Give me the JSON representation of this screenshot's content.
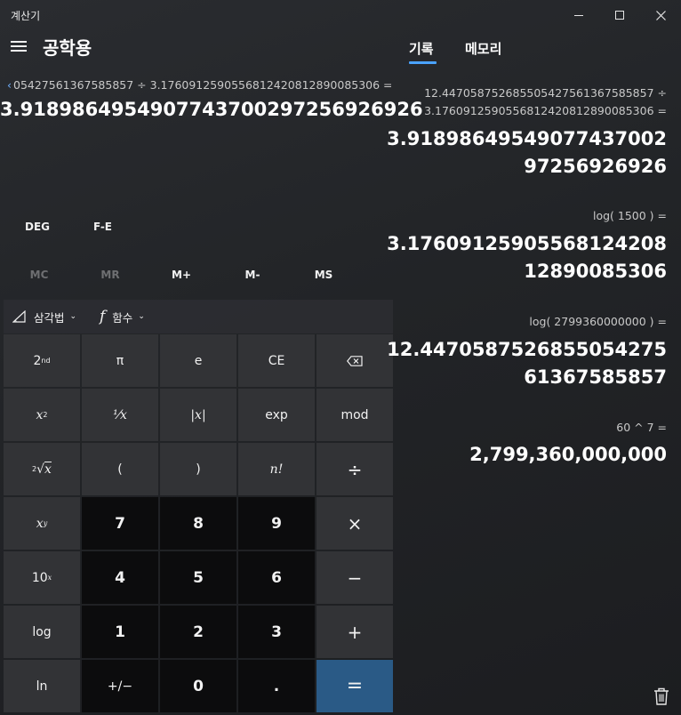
{
  "app": {
    "title": "계산기",
    "mode": "공학용"
  },
  "display": {
    "expression": "05427561367585857 ÷ 3.1760912590556812420812890085306 =",
    "result": "3.9189864954907743700297256926926"
  },
  "modes": {
    "angle": "DEG",
    "fe": "F-E"
  },
  "memory_buttons": [
    {
      "label": "MC",
      "enabled": false
    },
    {
      "label": "MR",
      "enabled": false
    },
    {
      "label": "M+",
      "enabled": true
    },
    {
      "label": "M-",
      "enabled": true
    },
    {
      "label": "MS",
      "enabled": true
    }
  ],
  "function_row": {
    "trig": "삼각법",
    "func": "함수"
  },
  "keys": {
    "second": "2",
    "second_sup": "nd",
    "pi": "π",
    "e": "e",
    "ce": "CE",
    "x": "x",
    "two": "2",
    "reciprocal": "⅟x",
    "abs": "|x|",
    "exp": "exp",
    "mod": "mod",
    "root_index": "2",
    "root_x": "x",
    "lparen": "(",
    "rparen": ")",
    "fact": "n!",
    "divide": "÷",
    "y": "y",
    "seven": "7",
    "eight": "8",
    "nine": "9",
    "times": "×",
    "ten": "10",
    "xsup": "x",
    "four": "4",
    "five": "5",
    "six": "6",
    "minus": "−",
    "log": "log",
    "one": "1",
    "two_num": "2",
    "three": "3",
    "plus": "+",
    "ln": "ln",
    "negate": "+/−",
    "zero": "0",
    "dot": ".",
    "equals": "="
  },
  "tabs": {
    "history": "기록",
    "memory": "메모리"
  },
  "history": [
    {
      "expr_line1": "12.447058752685505427561367585857   ÷",
      "expr_line2": "3.1760912590556812420812890085306 =",
      "result_line1": "3.91898649549077437002",
      "result_line2": "97256926926"
    },
    {
      "expr_line1": "log( 1500 ) =",
      "result_line1": "3.17609125905568124208",
      "result_line2": "12890085306"
    },
    {
      "expr_line1": "log( 2799360000000 ) =",
      "result_line1": "12.4470587526855054275",
      "result_line2": "61367585857"
    },
    {
      "expr_line1": "60   ^   7 =",
      "result_line1": "2,799,360,000,000"
    }
  ],
  "colors": {
    "accent": "#4aa3ff",
    "equals": "#2a5a86",
    "digit_key": "#0c0c0d",
    "func_key": "#323336"
  },
  "icons": [
    "hamburger-icon",
    "back-chevron-icon",
    "trig-icon",
    "function-icon",
    "backspace-icon",
    "trash-icon"
  ]
}
